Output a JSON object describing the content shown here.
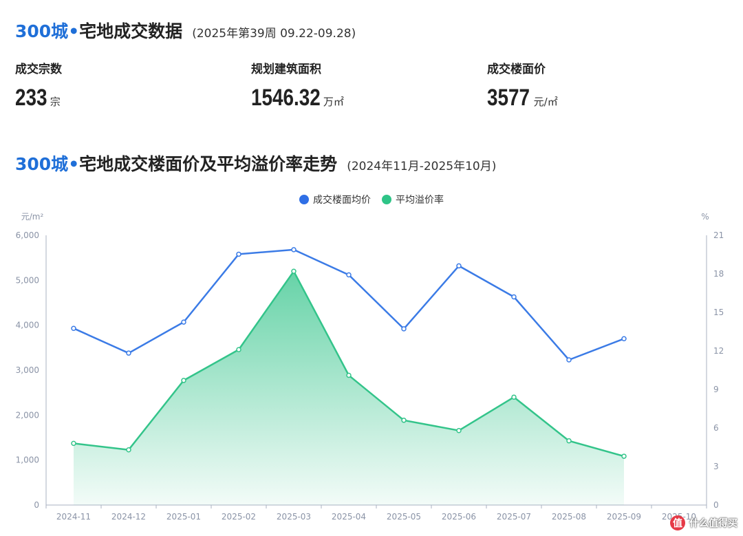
{
  "header": {
    "brand": "300城",
    "dot": "•",
    "title": "宅地成交数据",
    "period": "(2025年第39周 09.22-09.28)"
  },
  "stats": [
    {
      "label": "成交宗数",
      "value": "233",
      "unit": "宗"
    },
    {
      "label": "规划建筑面积",
      "value": "1546.32",
      "unit": "万㎡"
    },
    {
      "label": "成交楼面价",
      "value": "3577",
      "unit": "元/㎡"
    }
  ],
  "section": {
    "brand": "300城",
    "dot": "•",
    "title": "宅地成交楼面价及平均溢价率走势",
    "period": "(2024年11月-2025年10月)"
  },
  "colors": {
    "brand": "#1f6fd8",
    "price_line": "#3b7be6",
    "rate_line": "#33c48a",
    "axis": "#8a93a6"
  },
  "watermark": {
    "icon": "值",
    "text": "什么值得买"
  },
  "chart_data": {
    "type": "line",
    "x": [
      "2024-11",
      "2024-12",
      "2025-01",
      "2025-02",
      "2025-03",
      "2025-04",
      "2025-05",
      "2025-06",
      "2025-07",
      "2025-08",
      "2025-09",
      "2025-10"
    ],
    "y_left_unit": "元/m²",
    "y_right_unit": "%",
    "y_left_ticks": [
      "0",
      "1,000",
      "2,000",
      "3,000",
      "4,000",
      "5,000",
      "6,000"
    ],
    "y_right_ticks": [
      "0",
      "3",
      "6",
      "9",
      "12",
      "15",
      "18",
      "21"
    ],
    "ylim_left": [
      0,
      6000
    ],
    "ylim_right": [
      0,
      21
    ],
    "legend_position": "top-center",
    "grid": false,
    "series": [
      {
        "name": "成交楼面均价",
        "axis": "left",
        "color": "#3b7be6",
        "style": "line",
        "values": [
          3930,
          3380,
          4070,
          5580,
          5680,
          5120,
          3920,
          5320,
          4630,
          3230,
          3700,
          null
        ]
      },
      {
        "name": "平均溢价率",
        "axis": "right",
        "color": "#33c48a",
        "style": "area",
        "values": [
          4.8,
          4.3,
          9.7,
          12.1,
          18.2,
          10.1,
          6.6,
          5.8,
          8.4,
          5.0,
          3.8,
          null
        ]
      }
    ]
  }
}
